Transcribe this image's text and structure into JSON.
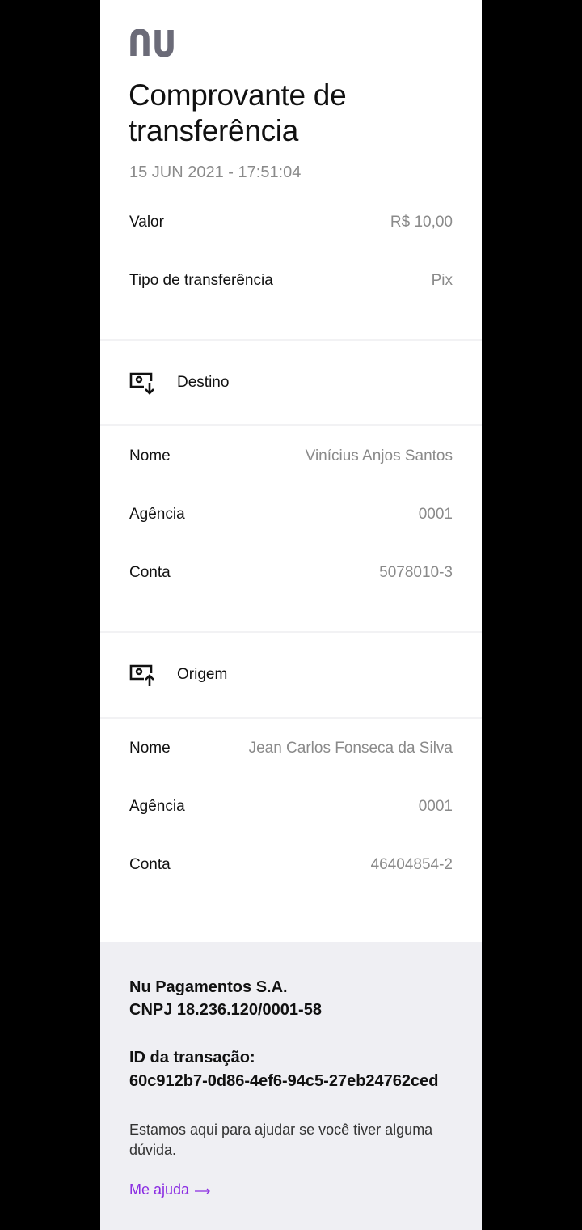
{
  "brand": {
    "logo_text": "nu",
    "logo_icon": "nubank-logo-icon"
  },
  "receipt": {
    "title": "Comprovante de transferência",
    "datetime": "15 JUN 2021 - 17:51:04",
    "summary": [
      {
        "label": "Valor",
        "value": "R$ 10,00"
      },
      {
        "label": "Tipo de transferência",
        "value": "Pix"
      }
    ],
    "destino": {
      "heading": "Destino",
      "icon": "money-in-icon",
      "rows": [
        {
          "label": "Nome",
          "value": "Vinícius Anjos Santos"
        },
        {
          "label": "Agência",
          "value": "0001"
        },
        {
          "label": "Conta",
          "value": "5078010-3"
        }
      ]
    },
    "origem": {
      "heading": "Origem",
      "icon": "money-out-icon",
      "rows": [
        {
          "label": "Nome",
          "value": "Jean Carlos Fonseca da Silva"
        },
        {
          "label": "Agência",
          "value": "0001"
        },
        {
          "label": "Conta",
          "value": "46404854-2"
        }
      ]
    }
  },
  "footer": {
    "company_name": "Nu Pagamentos S.A.",
    "cnpj": "CNPJ 18.236.120/0001-58",
    "transaction_id_label": "ID da transação:",
    "transaction_id": "60c912b7-0d86-4ef6-94c5-27eb24762ced",
    "help_text": "Estamos aqui para ajudar se você tiver alguma dúvida.",
    "help_link": "Me ajuda",
    "link_color": "#8a2be2"
  }
}
